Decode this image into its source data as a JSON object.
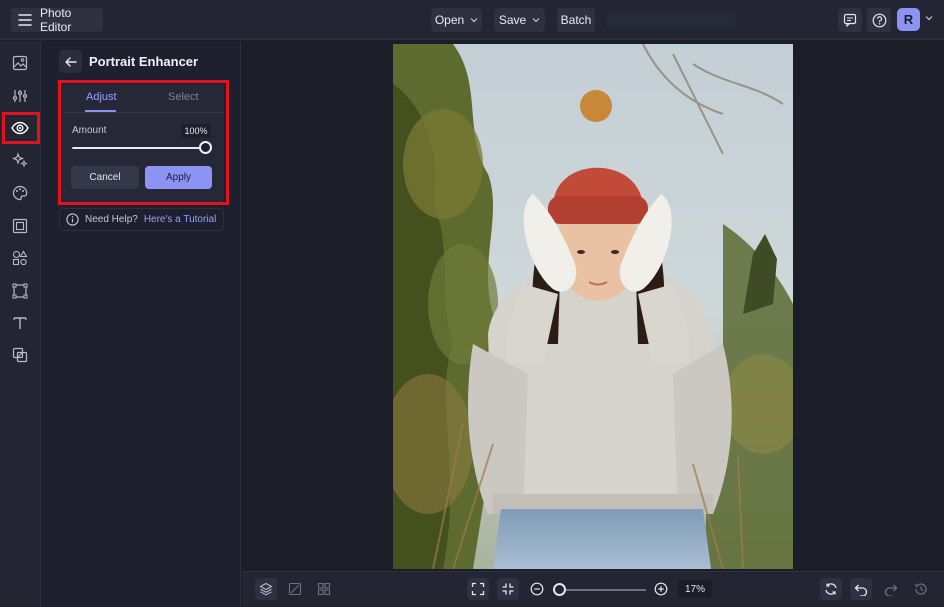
{
  "app": {
    "title": "Photo Editor"
  },
  "topbar": {
    "open_label": "Open",
    "save_label": "Save",
    "batch_label": "Batch",
    "avatar_initial": "R"
  },
  "panel": {
    "title": "Portrait Enhancer",
    "tabs": [
      {
        "label": "Adjust",
        "active": true
      },
      {
        "label": "Select",
        "active": false
      }
    ],
    "amount": {
      "label": "Amount",
      "value_text": "100%",
      "value": 100
    },
    "cancel_label": "Cancel",
    "apply_label": "Apply",
    "help": {
      "text": "Need Help?",
      "link": "Here's a Tutorial"
    }
  },
  "rail": {
    "items": [
      "image-icon",
      "sliders-icon",
      "eye-icon",
      "sparkle-icon",
      "palette-icon",
      "frame-icon",
      "shapes-icon",
      "crop-icon",
      "text-icon",
      "overlay-icon"
    ],
    "active": "eye-icon"
  },
  "bottombar": {
    "zoom_text": "17%",
    "zoom_fraction": 0.0
  },
  "colors": {
    "accent": "#8d92f5",
    "highlight": "#e2131c",
    "background": "#1b1d29",
    "panel": "#232532"
  }
}
